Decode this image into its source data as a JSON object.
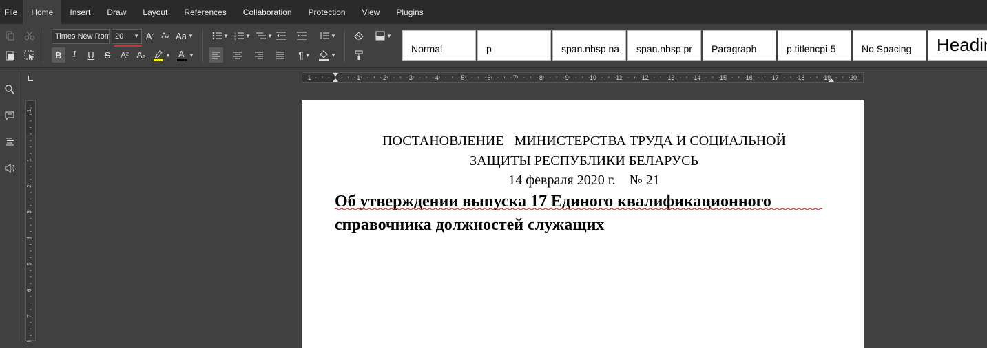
{
  "menubar": {
    "items": [
      "File",
      "Home",
      "Insert",
      "Draw",
      "Layout",
      "References",
      "Collaboration",
      "Protection",
      "View",
      "Plugins"
    ],
    "active": "Home"
  },
  "toolbar": {
    "font_name": "Times New Roman",
    "font_size": "20",
    "superscript_label": "A²",
    "subscript_label": "A₂",
    "bold_label": "B",
    "italic_label": "I",
    "underline_label": "U",
    "strike_label": "S",
    "grow_label": "A",
    "shrink_label": "A",
    "case_label": "Aa",
    "highlight_color": "#ffff00",
    "font_color": "#000000",
    "nonprint_label": "¶"
  },
  "styles": [
    "Normal",
    "p",
    "span.nbsp na",
    "span.nbsp pr",
    "Paragraph",
    "p.titlencpi-5",
    "No Spacing",
    "Heading"
  ],
  "ruler": {
    "h_numbers": [
      "1",
      "1",
      "2",
      "3",
      "4",
      "5",
      "6",
      "7",
      "8",
      "9",
      "10",
      "11",
      "12",
      "13",
      "14",
      "15",
      "16",
      "17",
      "18",
      "19",
      "20"
    ],
    "v_numbers": [
      "1",
      "1",
      "2",
      "3",
      "4",
      "5",
      "6",
      "7",
      "8"
    ]
  },
  "document": {
    "line1": "ПОСТАНОВЛЕНИЕ   МИНИСТЕРСТВА ТРУДА И СОЦИАЛЬНОЙ",
    "line2": "ЗАЩИТЫ РЕСПУБЛИКИ БЕЛАРУСЬ",
    "line3": "14 февраля 2020 г.    № 21",
    "heading1": "Об утверждении выпуска 17 Единого квалификационного",
    "heading2": "справочника должностей служащих"
  },
  "colors": {
    "menubar_bg": "#2a2a2a",
    "toolbar_bg": "#404040",
    "page_bg": "#ffffff",
    "spellcheck": "#d32f2f"
  }
}
